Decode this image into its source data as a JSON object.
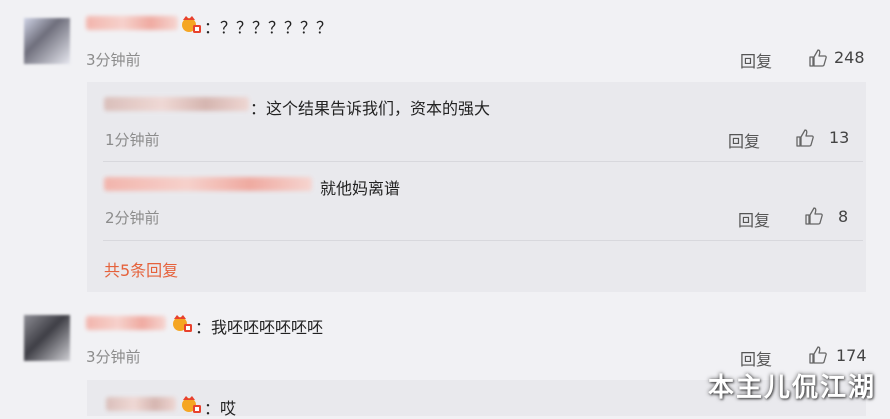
{
  "comments": [
    {
      "text": "：？？？？？？？",
      "time": "3分钟前",
      "reply_label": "回复",
      "likes": "248",
      "replies": [
        {
          "text": "：这个结果告诉我们，资本的强大",
          "time": "1分钟前",
          "reply_label": "回复",
          "likes": "13"
        },
        {
          "text": "就他妈离谱",
          "time": "2分钟前",
          "reply_label": "回复",
          "likes": "8"
        }
      ],
      "more_replies": "共5条回复"
    },
    {
      "text": "：我呸呸呸呸呸呸",
      "time": "3分钟前",
      "reply_label": "回复",
      "likes": "174",
      "replies": [
        {
          "text": "：哎"
        }
      ]
    }
  ],
  "watermark": "本主儿侃江湖",
  "icons": [
    "vip-crown-icon",
    "like-thumb-icon"
  ],
  "colors": {
    "accent": "#e5623c",
    "background": "#f1f1f4",
    "reply_bg": "#e9e9ed"
  }
}
